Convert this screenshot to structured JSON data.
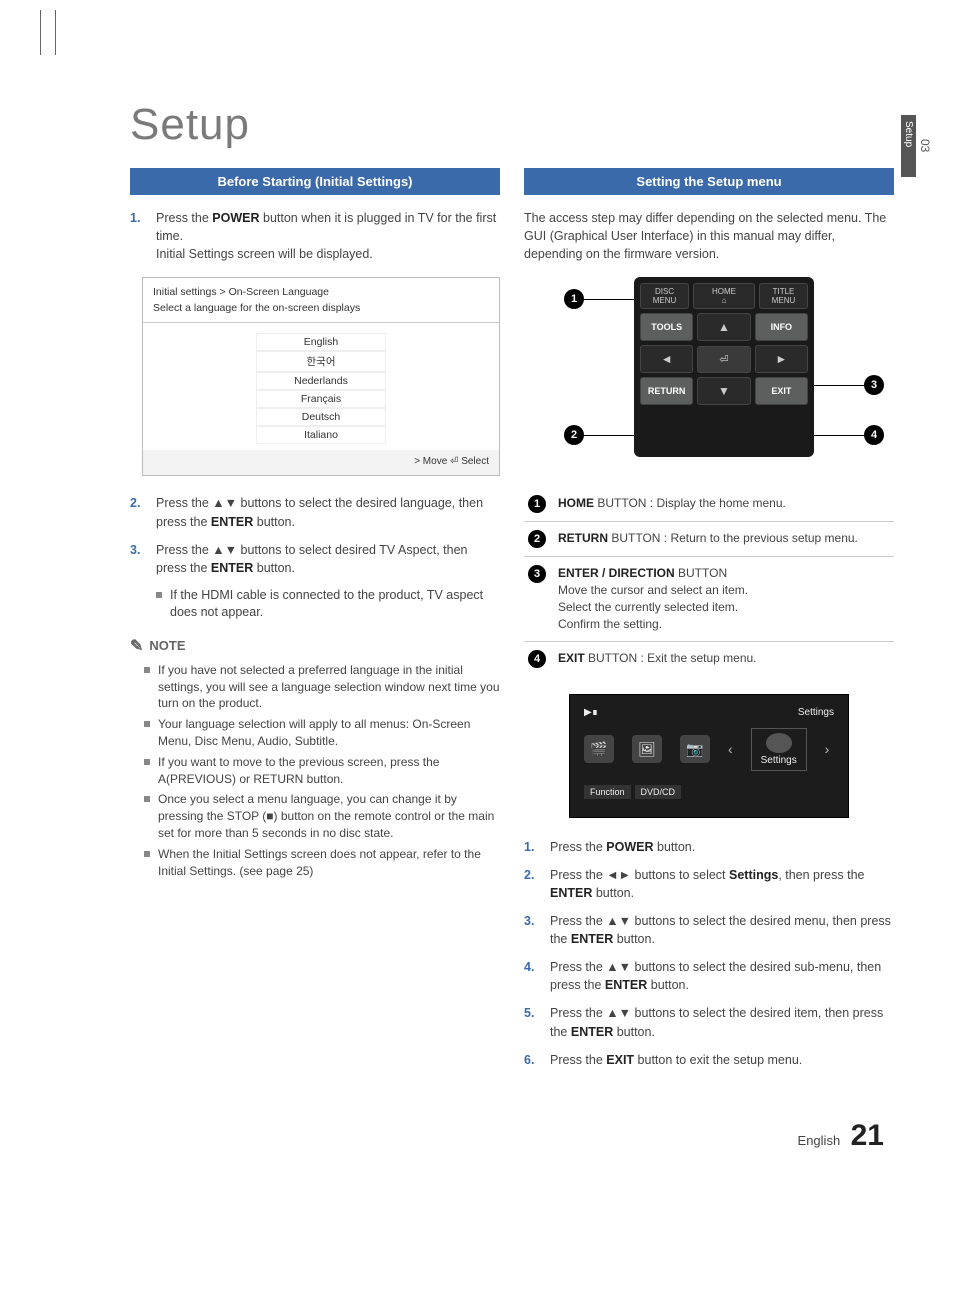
{
  "sideTab": {
    "num": "03",
    "label": "Setup"
  },
  "title": "Setup",
  "left": {
    "bar": "Before Starting (Initial Settings)",
    "step1": {
      "n": "1.",
      "t1": "Press the ",
      "b1": "POWER",
      "t2": " button when it is plugged in TV for the first time.",
      "t3": "Initial Settings screen will be displayed."
    },
    "langbox": {
      "hdr": "Initial settings > On-Screen Language",
      "sub": "Select a language for the on-screen displays",
      "items": [
        "English",
        "한국어",
        "Nederlands",
        "Français",
        "Deutsch",
        "Italiano"
      ],
      "foot": "> Move    ",
      "foot2": "⏎ Select"
    },
    "step2": {
      "n": "2.",
      "t1": "Press the ▲▼ buttons to select the desired language, then press the ",
      "b1": "ENTER",
      "t2": " button."
    },
    "step3": {
      "n": "3.",
      "t1": "Press the ▲▼ buttons to select desired TV Aspect, then press the ",
      "b1": "ENTER",
      "t2": " button."
    },
    "step3sub": "If the HDMI cable is connected to the product, TV aspect does not appear.",
    "noteHead": "NOTE",
    "notes": [
      "If you have not selected a preferred language in the initial settings, you will see a language selection window next time you turn on the product.",
      "Your language selection will apply to all menus: On-Screen Menu, Disc Menu, Audio, Subtitle.",
      "If you want to move to the previous screen, press the A(PREVIOUS) or RETURN button.",
      "Once you select a menu language, you can change it by pressing the STOP (■) button on the remote control or the main set  for more than 5 seconds in no disc state.",
      "When the Initial Settings screen does not appear, refer to the Initial Settings. (see page 25)"
    ]
  },
  "right": {
    "bar": "Setting the Setup menu",
    "intro": "The access step may differ depending on the selected menu. The GUI (Graphical User Interface) in this manual may differ, depending on the firmware version.",
    "remote": {
      "top": [
        "DISC MENU",
        "HOME",
        "TITLE MENU"
      ],
      "mid": [
        "TOOLS",
        "INFO"
      ],
      "bot": [
        "RETURN",
        "EXIT"
      ]
    },
    "legend": [
      {
        "n": "1",
        "b": "HOME",
        "t": " BUTTON : Display the home menu."
      },
      {
        "n": "2",
        "b": "RETURN",
        "t": " BUTTON : Return to the previous setup menu."
      },
      {
        "n": "3",
        "b": "ENTER / DIRECTION",
        "t": " BUTTON",
        "extra": [
          "Move the cursor and select an item.",
          "Select the currently selected item.",
          "Confirm the setting."
        ]
      },
      {
        "n": "4",
        "b": "EXIT",
        "t": " BUTTON : Exit the setup menu."
      }
    ],
    "tv": {
      "topRight": "Settings",
      "selected": "Settings",
      "foot": [
        "Function",
        "DVD/CD"
      ]
    },
    "steps": [
      {
        "n": "1.",
        "t1": "Press the ",
        "b1": "POWER",
        "t2": " button."
      },
      {
        "n": "2.",
        "t1": "Press the ◄► buttons to select ",
        "b1": "Settings",
        "t2": ", then press the ",
        "b2": "ENTER",
        "t3": " button."
      },
      {
        "n": "3.",
        "t1": "Press the ▲▼ buttons to select the desired menu, then press the ",
        "b1": "ENTER",
        "t2": " button."
      },
      {
        "n": "4.",
        "t1": "Press the ▲▼ buttons to select the desired sub-menu, then press the ",
        "b1": "ENTER",
        "t2": " button."
      },
      {
        "n": "5.",
        "t1": "Press the ▲▼ buttons to select the desired item, then press the ",
        "b1": "ENTER",
        "t2": " button."
      },
      {
        "n": "6.",
        "t1": "Press the ",
        "b1": "EXIT",
        "t2": " button to exit the setup menu."
      }
    ]
  },
  "footer": {
    "lang": "English",
    "page": "21"
  }
}
